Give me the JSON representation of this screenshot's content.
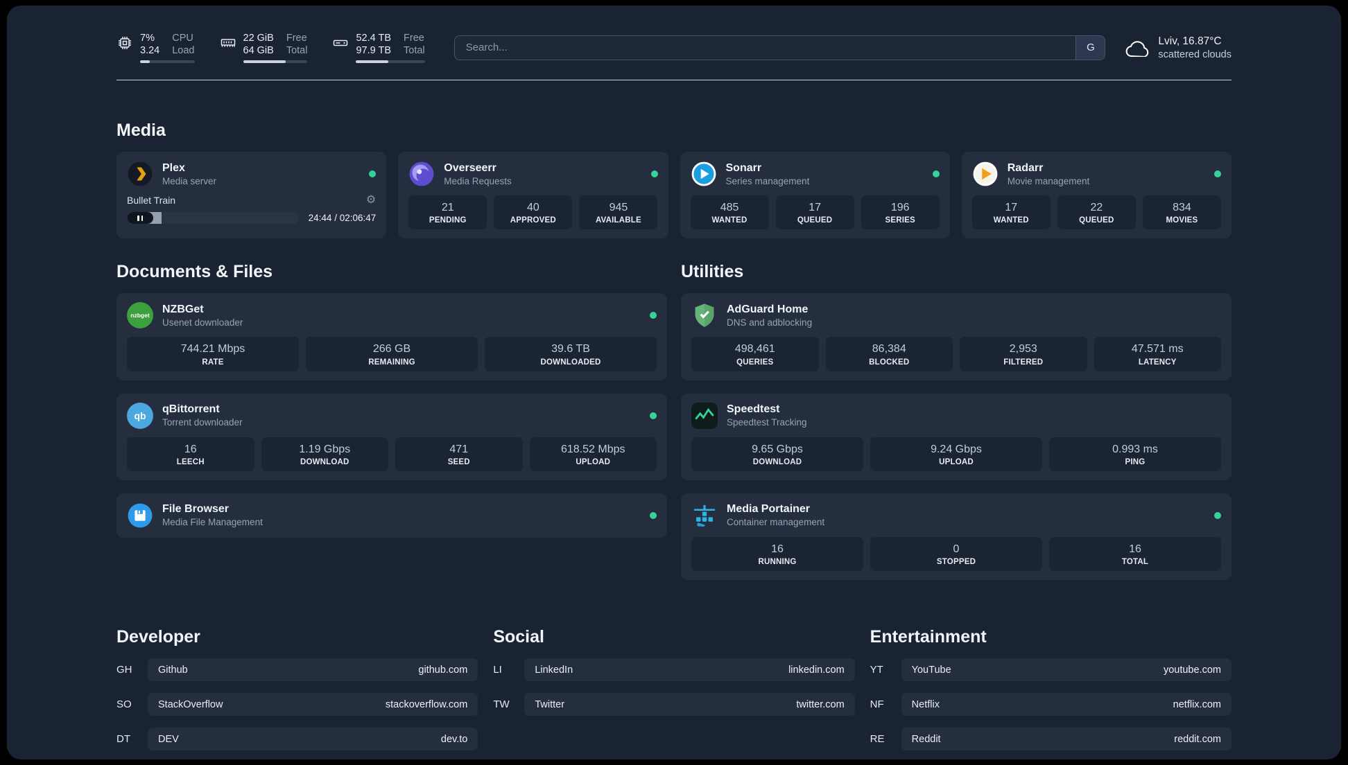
{
  "topbar": {
    "cpu": {
      "value_top": "7%",
      "value_bottom": "3.24",
      "label_top": "CPU",
      "label_bottom": "Load"
    },
    "memory": {
      "value_top": "22 GiB",
      "value_bottom": "64 GiB",
      "label_top": "Free",
      "label_bottom": "Total"
    },
    "disk": {
      "value_top": "52.4 TB",
      "value_bottom": "97.9 TB",
      "label_top": "Free",
      "label_bottom": "Total"
    },
    "search": {
      "placeholder": "Search...",
      "button": "G"
    },
    "weather": {
      "location": "Lviv, 16.87°C",
      "condition": "scattered clouds"
    }
  },
  "colors": {
    "accent_green": "#35d399",
    "plex_gold": "#e5a00d"
  },
  "media": {
    "title": "Media",
    "plex": {
      "name": "Plex",
      "desc": "Media server",
      "now_playing": "Bullet Train",
      "time": "24:44 / 02:06:47"
    },
    "overseerr": {
      "name": "Overseerr",
      "desc": "Media Requests",
      "stats": [
        {
          "value": "21",
          "label": "PENDING"
        },
        {
          "value": "40",
          "label": "APPROVED"
        },
        {
          "value": "945",
          "label": "AVAILABLE"
        }
      ]
    },
    "sonarr": {
      "name": "Sonarr",
      "desc": "Series management",
      "stats": [
        {
          "value": "485",
          "label": "WANTED"
        },
        {
          "value": "17",
          "label": "QUEUED"
        },
        {
          "value": "196",
          "label": "SERIES"
        }
      ]
    },
    "radarr": {
      "name": "Radarr",
      "desc": "Movie management",
      "stats": [
        {
          "value": "17",
          "label": "WANTED"
        },
        {
          "value": "22",
          "label": "QUEUED"
        },
        {
          "value": "834",
          "label": "MOVIES"
        }
      ]
    }
  },
  "documents": {
    "title": "Documents & Files",
    "nzbget": {
      "name": "NZBGet",
      "desc": "Usenet downloader",
      "icon_text": "nzbget",
      "stats": [
        {
          "value": "744.21 Mbps",
          "label": "RATE"
        },
        {
          "value": "266 GB",
          "label": "REMAINING"
        },
        {
          "value": "39.6 TB",
          "label": "DOWNLOADED"
        }
      ]
    },
    "qbittorrent": {
      "name": "qBittorrent",
      "desc": "Torrent downloader",
      "icon_text": "qb",
      "stats": [
        {
          "value": "16",
          "label": "LEECH"
        },
        {
          "value": "1.19 Gbps",
          "label": "DOWNLOAD"
        },
        {
          "value": "471",
          "label": "SEED"
        },
        {
          "value": "618.52 Mbps",
          "label": "UPLOAD"
        }
      ]
    },
    "filebrowser": {
      "name": "File Browser",
      "desc": "Media File Management"
    }
  },
  "utilities": {
    "title": "Utilities",
    "adguard": {
      "name": "AdGuard Home",
      "desc": "DNS and adblocking",
      "stats": [
        {
          "value": "498,461",
          "label": "QUERIES"
        },
        {
          "value": "86,384",
          "label": "BLOCKED"
        },
        {
          "value": "2,953",
          "label": "FILTERED"
        },
        {
          "value": "47.571 ms",
          "label": "LATENCY"
        }
      ]
    },
    "speedtest": {
      "name": "Speedtest",
      "desc": "Speedtest Tracking",
      "stats": [
        {
          "value": "9.65 Gbps",
          "label": "DOWNLOAD"
        },
        {
          "value": "9.24 Gbps",
          "label": "UPLOAD"
        },
        {
          "value": "0.993 ms",
          "label": "PING"
        }
      ]
    },
    "portainer": {
      "name": "Media Portainer",
      "desc": "Container management",
      "stats": [
        {
          "value": "16",
          "label": "RUNNING"
        },
        {
          "value": "0",
          "label": "STOPPED"
        },
        {
          "value": "16",
          "label": "TOTAL"
        }
      ]
    }
  },
  "bookmarks": {
    "developer": {
      "title": "Developer",
      "items": [
        {
          "abbr": "GH",
          "name": "Github",
          "url": "github.com"
        },
        {
          "abbr": "SO",
          "name": "StackOverflow",
          "url": "stackoverflow.com"
        },
        {
          "abbr": "DT",
          "name": "DEV",
          "url": "dev.to"
        }
      ]
    },
    "social": {
      "title": "Social",
      "items": [
        {
          "abbr": "LI",
          "name": "LinkedIn",
          "url": "linkedin.com"
        },
        {
          "abbr": "TW",
          "name": "Twitter",
          "url": "twitter.com"
        }
      ]
    },
    "entertainment": {
      "title": "Entertainment",
      "items": [
        {
          "abbr": "YT",
          "name": "YouTube",
          "url": "youtube.com"
        },
        {
          "abbr": "NF",
          "name": "Netflix",
          "url": "netflix.com"
        },
        {
          "abbr": "RE",
          "name": "Reddit",
          "url": "reddit.com"
        }
      ]
    }
  }
}
